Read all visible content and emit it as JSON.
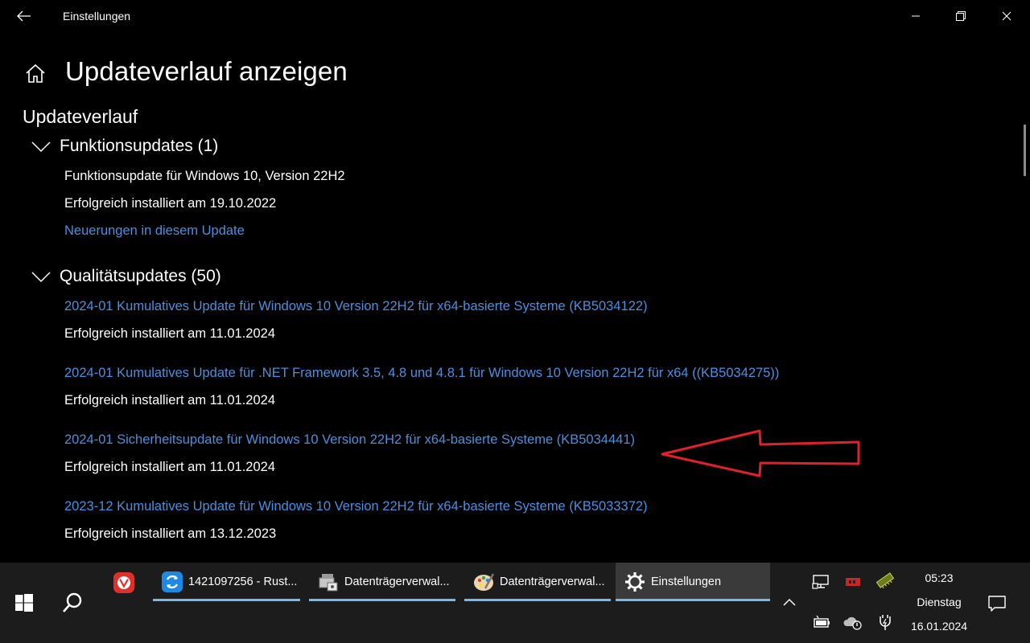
{
  "window": {
    "title": "Einstellungen"
  },
  "header": {
    "page_title": "Updateverlauf anzeigen",
    "section_title": "Updateverlauf"
  },
  "feature_updates": {
    "heading": "Funktionsupdates (1)",
    "name": "Funktionsupdate für Windows 10, Version 22H2",
    "status": "Erfolgreich installiert am 19.10.2022",
    "link": "Neuerungen in diesem Update"
  },
  "quality_updates": {
    "heading": "Qualitätsupdates (50)",
    "items": [
      {
        "name": "2024-01 Kumulatives Update für Windows 10 Version 22H2 für x64-basierte Systeme (KB5034122)",
        "status": "Erfolgreich installiert am 11.01.2024"
      },
      {
        "name": "2024-01 Kumulatives Update für .NET Framework 3.5, 4.8 und 4.8.1 für Windows 10 Version 22H2 für x64 ((KB5034275))",
        "status": "Erfolgreich installiert am 11.01.2024"
      },
      {
        "name": "2024-01 Sicherheitsupdate für Windows 10 Version 22H2 für x64-basierte Systeme (KB5034441)",
        "status": "Erfolgreich installiert am 11.01.2024"
      },
      {
        "name": "2023-12 Kumulatives Update für Windows 10 Version 22H2 für x64-basierte Systeme (KB5033372)",
        "status": "Erfolgreich installiert am 13.12.2023"
      }
    ]
  },
  "taskbar": {
    "apps": [
      {
        "label": "1421097256 - Rust...",
        "icon": "sync-icon"
      },
      {
        "label": "Datenträgerverwal...",
        "icon": "disk-management-icon"
      },
      {
        "label": "Datenträgerverwal...",
        "icon": "paint-palette-icon"
      },
      {
        "label": "Einstellungen",
        "icon": "gear-icon"
      }
    ],
    "clock": {
      "time": "05:23",
      "day": "Dienstag",
      "date": "16.01.2024"
    }
  },
  "colors": {
    "link": "#4a8fe0",
    "annotation_arrow": "#e0202a",
    "taskbar_accent": "#76b9ed"
  }
}
